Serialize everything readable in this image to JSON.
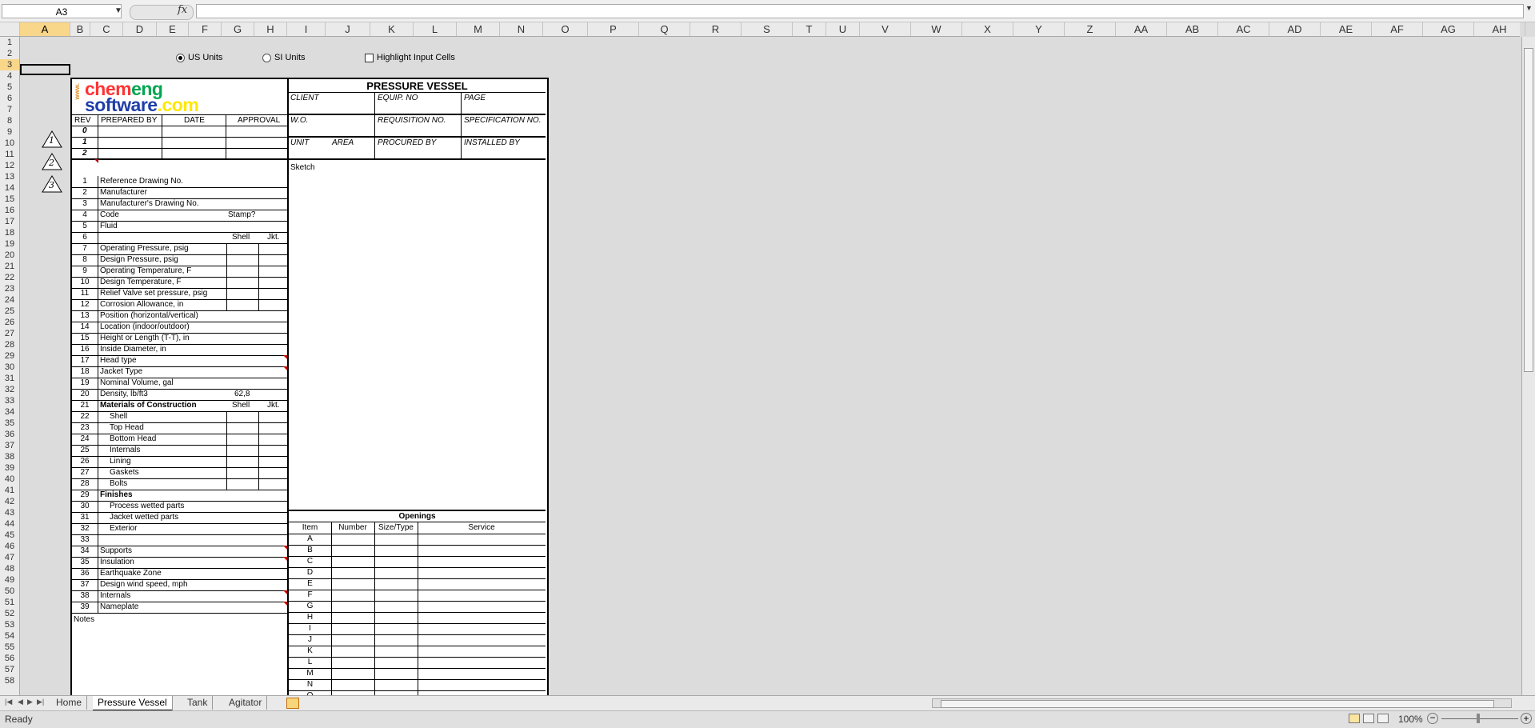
{
  "formula_bar": {
    "name_box": "A3",
    "fx_label": "fx",
    "formula": ""
  },
  "columns": [
    "A",
    "B",
    "C",
    "D",
    "E",
    "F",
    "G",
    "H",
    "I",
    "J",
    "K",
    "L",
    "M",
    "N",
    "O",
    "P",
    "Q",
    "R",
    "S",
    "T",
    "U",
    "V",
    "W",
    "X",
    "Y",
    "Z",
    "AA",
    "AB",
    "AC",
    "AD",
    "AE",
    "AF",
    "AG",
    "AH"
  ],
  "selected_column": "A",
  "rows": [
    "1",
    "2",
    "3",
    "4",
    "5",
    "6",
    "7",
    "8",
    "9",
    "10",
    "11",
    "12",
    "13",
    "14",
    "15",
    "16",
    "17",
    "18",
    "19",
    "20",
    "21",
    "22",
    "23",
    "24",
    "25",
    "26",
    "27",
    "28",
    "29",
    "30",
    "31",
    "32",
    "33",
    "34",
    "35",
    "36",
    "37",
    "38",
    "39",
    "40",
    "41",
    "42",
    "43",
    "44",
    "45",
    "46",
    "47",
    "48",
    "49",
    "50",
    "51",
    "52",
    "53",
    "54",
    "55",
    "56",
    "57",
    "58"
  ],
  "selected_row": "3",
  "controls": {
    "us_units": "US Units",
    "si_units": "SI Units",
    "highlight": "Highlight Input Cells",
    "us_selected": true,
    "highlight_checked": false
  },
  "logo": {
    "www": "www.",
    "line1": "chemeng",
    "line2": "software.com",
    "color1": "#00a651",
    "color2": "#ff3333",
    "color3": "#1f3ea8",
    "color4": "#ffe800"
  },
  "header": {
    "title": "PRESSURE VESSEL",
    "client": "CLIENT",
    "equip_no": "EQUIP. NO",
    "page": "PAGE",
    "wo": "W.O.",
    "requisition": "REQUISITION NO.",
    "specification": "SPECIFICATION NO.",
    "unit": "UNIT",
    "area": "AREA",
    "procured_by": "PROCURED BY",
    "installed_by": "INSTALLED BY"
  },
  "revision_table": {
    "rev": "REV",
    "prepared_by": "PREPARED BY",
    "date": "DATE",
    "approval": "APPROVAL",
    "revs": [
      "0",
      "1",
      "2"
    ]
  },
  "revision_triangles": [
    "1",
    "2",
    "3"
  ],
  "items": [
    {
      "n": "1",
      "label": "Reference Drawing No."
    },
    {
      "n": "2",
      "label": "Manufacturer"
    },
    {
      "n": "3",
      "label": "Manufacturer's Drawing No."
    },
    {
      "n": "4",
      "label": "Code",
      "extra": "Stamp?"
    },
    {
      "n": "5",
      "label": "Fluid"
    },
    {
      "n": "6",
      "label": "",
      "shell": "Shell",
      "jkt": "Jkt."
    },
    {
      "n": "7",
      "label": "Operating Pressure, psig"
    },
    {
      "n": "8",
      "label": "Design Pressure, psig"
    },
    {
      "n": "9",
      "label": "Operating Temperature, F"
    },
    {
      "n": "10",
      "label": "Design Temperature, F"
    },
    {
      "n": "11",
      "label": "Relief Valve set pressure, psig"
    },
    {
      "n": "12",
      "label": "Corrosion Allowance, in"
    },
    {
      "n": "13",
      "label": "Position (horizontal/vertical)"
    },
    {
      "n": "14",
      "label": "Location (indoor/outdoor)"
    },
    {
      "n": "15",
      "label": "Height or Length (T-T), in"
    },
    {
      "n": "16",
      "label": "Inside Diameter, in"
    },
    {
      "n": "17",
      "label": "Head type"
    },
    {
      "n": "18",
      "label": "Jacket Type"
    },
    {
      "n": "19",
      "label": "Nominal Volume, gal"
    },
    {
      "n": "20",
      "label": "Density, lb/ft3",
      "value": "62,8"
    },
    {
      "n": "21",
      "label": "Materials of Construction",
      "shell": "Shell",
      "jkt": "Jkt."
    },
    {
      "n": "22",
      "label": "Shell"
    },
    {
      "n": "23",
      "label": "Top Head"
    },
    {
      "n": "24",
      "label": "Bottom Head"
    },
    {
      "n": "25",
      "label": "Internals"
    },
    {
      "n": "26",
      "label": "Lining"
    },
    {
      "n": "27",
      "label": "Gaskets"
    },
    {
      "n": "28",
      "label": "Bolts"
    },
    {
      "n": "29",
      "label": "Finishes"
    },
    {
      "n": "30",
      "label": "Process wetted parts"
    },
    {
      "n": "31",
      "label": "Jacket wetted parts"
    },
    {
      "n": "32",
      "label": "Exterior"
    },
    {
      "n": "33",
      "label": ""
    },
    {
      "n": "34",
      "label": "Supports"
    },
    {
      "n": "35",
      "label": "Insulation"
    },
    {
      "n": "36",
      "label": "Earthquake Zone"
    },
    {
      "n": "37",
      "label": "Design wind speed, mph"
    },
    {
      "n": "38",
      "label": "Internals"
    },
    {
      "n": "39",
      "label": "Nameplate"
    }
  ],
  "notes_label": "Notes",
  "sketch_label": "Sketch",
  "openings": {
    "title": "Openings",
    "headers": [
      "Item",
      "Number",
      "Size/Type",
      "Service"
    ],
    "items": [
      "A",
      "B",
      "C",
      "D",
      "E",
      "F",
      "G",
      "H",
      "I",
      "J",
      "K",
      "L",
      "M",
      "N",
      "O"
    ]
  },
  "tabs": [
    "Home",
    "Pressure Vessel",
    "Tank",
    "Agitator"
  ],
  "active_tab": "Pressure Vessel",
  "status": {
    "text": "Ready",
    "zoom": "100%"
  }
}
